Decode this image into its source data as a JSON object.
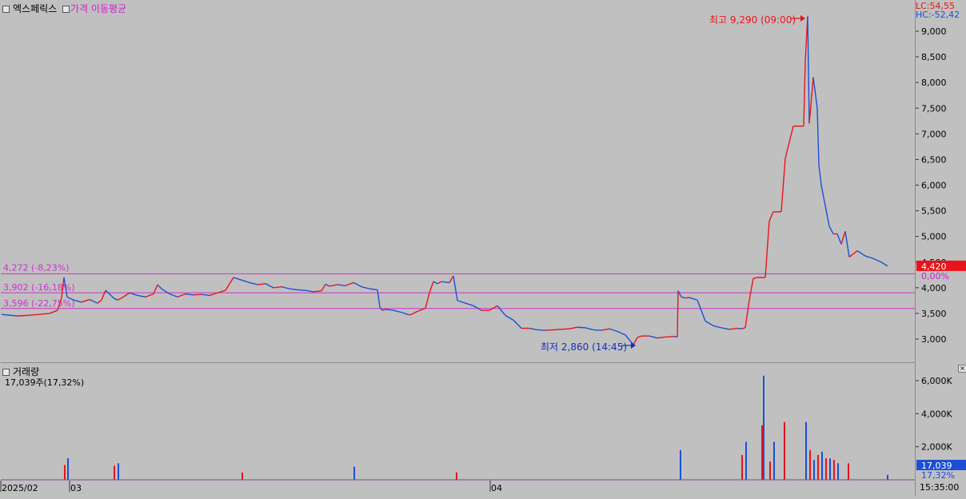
{
  "legend": {
    "stock_name": "엑스페릭스",
    "indicator": "가격 이동평균",
    "volume_title": "거래량",
    "volume_value": "17,039주(17,32%)"
  },
  "right_header": {
    "lc": "LC:54,55",
    "hc": "HC:-52,42"
  },
  "current": {
    "price_tag": "4,420",
    "pct_tag": "0,00%",
    "volume_tag": "17,039",
    "volume_pct_tag": "17,32%"
  },
  "annotations": {
    "high": "최고 9,290 (09:00)",
    "low": "최저 2,860 (14:45)"
  },
  "hlines": [
    {
      "label": "4,272 (-8,23%)",
      "value": 4272
    },
    {
      "label": "3,902 (-16,18%)",
      "value": 3902
    },
    {
      "label": "3,596 (-22,75%)",
      "value": 3596
    }
  ],
  "x_axis": {
    "labels": [
      "2025/02",
      "03",
      "04"
    ],
    "time": "15:35:00"
  },
  "colors": {
    "up": "#e8141b",
    "down": "#1c4fd6",
    "hline": "#cc33cc",
    "high": "#e8141b",
    "low": "#1030c0",
    "background": "#c0c0c0"
  },
  "icons": {
    "legend_box": "square-checkbox-icon",
    "close_volume": "close-x-icon",
    "arrow_high": "arrow-right-icon",
    "arrow_low": "arrow-right-icon"
  },
  "chart_data": {
    "type": "line",
    "price_axis": {
      "ticks": [
        "3,000",
        "3,500",
        "4,000",
        "4,500",
        "5,000",
        "5,500",
        "6,000",
        "6,500",
        "7,000",
        "7,500",
        "8,000",
        "8,500",
        "9,000"
      ],
      "range": [
        2700,
        9500
      ]
    },
    "volume_axis": {
      "ticks": [
        "2,000K",
        "4,000K",
        "6,000K"
      ],
      "range": [
        0,
        6500
      ]
    },
    "price_series": {
      "t": [
        0,
        20,
        40,
        60,
        70,
        75,
        78,
        82,
        90,
        100,
        110,
        120,
        125,
        130,
        140,
        145,
        150,
        160,
        170,
        180,
        190,
        195,
        200,
        210,
        220,
        230,
        240,
        250,
        260,
        270,
        280,
        290,
        300,
        310,
        320,
        330,
        340,
        350,
        360,
        370,
        380,
        390,
        400,
        405,
        410,
        420,
        430,
        440,
        450,
        460,
        470,
        473,
        476,
        480,
        490,
        500,
        510,
        515,
        520,
        530,
        535,
        540,
        545,
        550,
        560,
        565,
        570,
        580,
        590,
        600,
        610,
        620,
        630,
        640,
        650,
        660,
        670,
        680,
        690,
        700,
        710,
        720,
        730,
        740,
        750,
        760,
        770,
        780,
        790,
        795,
        800,
        810,
        820,
        830,
        840,
        845,
        846,
        850,
        855,
        860,
        870,
        880,
        890,
        900,
        910,
        920,
        925,
        930,
        935,
        940,
        945,
        950,
        955,
        960,
        965,
        970,
        975,
        980,
        990,
        1000,
        1003,
        1005,
        1008,
        1010,
        1015,
        1020,
        1022,
        1025,
        1030,
        1035,
        1040,
        1045,
        1050,
        1055,
        1060,
        1070,
        1080,
        1090,
        1100,
        1108
      ],
      "p": [
        3480,
        3450,
        3470,
        3500,
        3560,
        3800,
        4200,
        3820,
        3760,
        3720,
        3770,
        3700,
        3760,
        3950,
        3800,
        3760,
        3800,
        3900,
        3850,
        3820,
        3880,
        4060,
        3980,
        3880,
        3820,
        3880,
        3860,
        3870,
        3850,
        3900,
        3950,
        4200,
        4150,
        4100,
        4060,
        4080,
        4000,
        4020,
        3980,
        3960,
        3950,
        3920,
        3940,
        4070,
        4030,
        4060,
        4040,
        4100,
        4020,
        3980,
        3960,
        3620,
        3560,
        3580,
        3560,
        3520,
        3470,
        3500,
        3540,
        3600,
        3900,
        4120,
        4080,
        4120,
        4100,
        4230,
        3750,
        3700,
        3650,
        3560,
        3560,
        3650,
        3460,
        3370,
        3210,
        3210,
        3180,
        3170,
        3180,
        3190,
        3200,
        3230,
        3220,
        3180,
        3170,
        3200,
        3150,
        3080,
        2890,
        3030,
        3060,
        3060,
        3020,
        3040,
        3050,
        3040,
        3940,
        3820,
        3800,
        3810,
        3760,
        3350,
        3260,
        3220,
        3190,
        3210,
        3200,
        3220,
        3760,
        4180,
        4200,
        4200,
        4200,
        5300,
        5480,
        5480,
        5480,
        6520,
        7150,
        7150,
        7150,
        8400,
        9290,
        7200,
        8100,
        7500,
        6400,
        6000,
        5600,
        5200,
        5050,
        5050,
        4850,
        5100,
        4600,
        4720,
        4620,
        4570,
        4500,
        4420
      ]
    },
    "volume_series": {
      "t": [
        78,
        82,
        140,
        145,
        300,
        440,
        568,
        848,
        925,
        930,
        950,
        952,
        960,
        965,
        978,
        1005,
        1010,
        1015,
        1020,
        1025,
        1030,
        1035,
        1040,
        1045,
        1058,
        1107
      ],
      "v": [
        900,
        1300,
        850,
        1000,
        450,
        800,
        450,
        1800,
        1500,
        2300,
        3300,
        6300,
        1100,
        2300,
        3500,
        3500,
        1800,
        1200,
        1500,
        1700,
        1300,
        1300,
        1200,
        1000,
        1000,
        300
      ]
    }
  }
}
